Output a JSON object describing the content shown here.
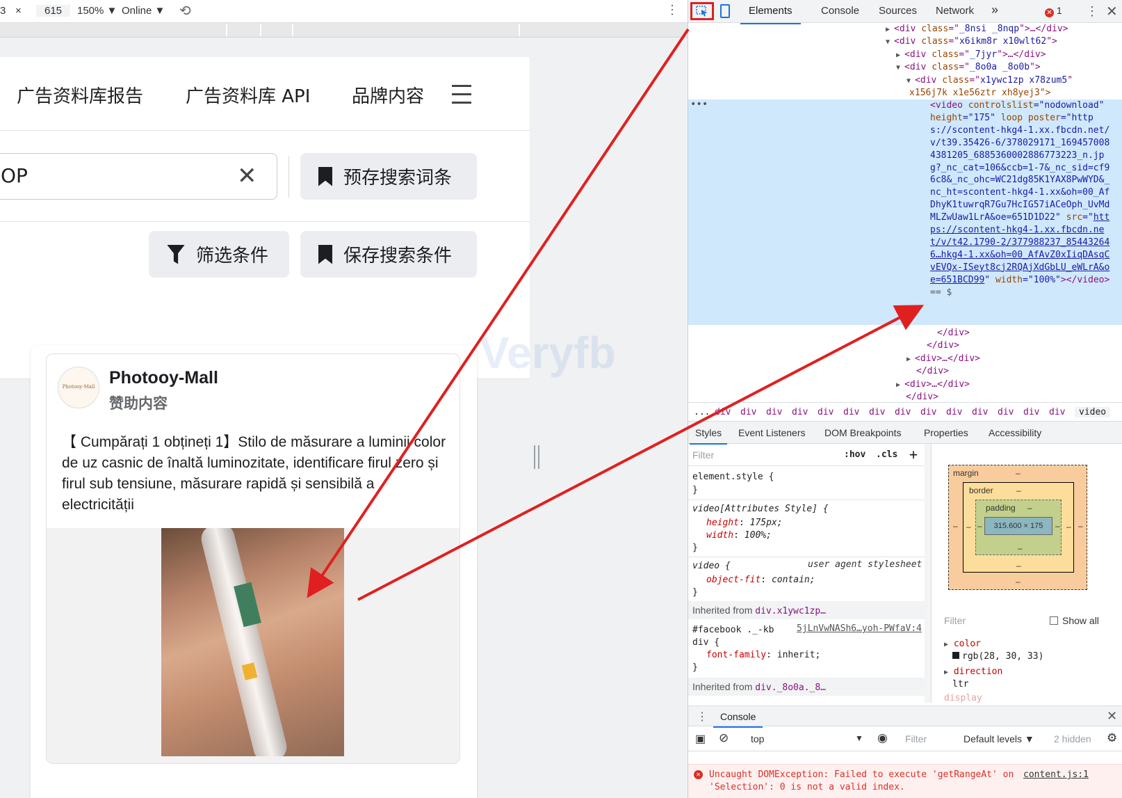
{
  "device_toolbar": {
    "width": "3",
    "times": "×",
    "height": "615",
    "zoom": "150% ▼",
    "network": "Online ▼",
    "rotate_icon": "rotate-icon"
  },
  "site": {
    "nav": [
      "广告资料库报告",
      "广告资料库 API",
      "品牌内容"
    ],
    "search_value": "OP",
    "save_terms": "预存搜索词条",
    "filter": "筛选条件",
    "save_search": "保存搜索条件",
    "watermark": "Veryfb"
  },
  "ad": {
    "avatar_text": "Photooy-Mall",
    "page_name": "Photooy-Mall",
    "sponsored": "赞助内容",
    "body": "【 Cumpărați 1 obțineți 1】Stilo de măsurare a luminii color de uz casnic de înaltă luminozitate, identificare firul zero și firul sub tensiune, măsurare rapidă și sensibilă a electricității"
  },
  "devtools": {
    "tabs": [
      "Elements",
      "Console",
      "Sources",
      "Network",
      "»"
    ],
    "error_count": "1",
    "dom_lines": [
      {
        "indent": 0,
        "tri": "▶",
        "cls": "_8nsi _8nqp",
        "tail": ">…</div>"
      },
      {
        "indent": 0,
        "tri": "▼",
        "cls": "x6ikm8r x10wlt62",
        "tail": ">"
      },
      {
        "indent": 1,
        "tri": "▶",
        "cls": "_7jyr",
        "tail": ">…</div>"
      },
      {
        "indent": 1,
        "tri": "▼",
        "cls": "_8o0a _8o0b",
        "tail": ">"
      },
      {
        "indent": 2,
        "tri": "▼",
        "cls": "x1ywc1zp x78zum5",
        "tail": ""
      }
    ],
    "dom_wrap": "x156j7k x1e56ztr xh8yej3\">",
    "video_tag": {
      "controlslist": "nodownload",
      "height": "175",
      "poster": "https://scontent-hkg4-1.xx.fbcdn.net/v/t39.35426-6/378029171_1694570084381205_6885360002886773223_n.jpg?_nc_cat=106&ccb=1-7&_nc_sid=cf96c8&_nc_ohc=WC21dg85K1YAX8PwWYD&_nc_ht=scontent-hkg4-1.xx&oh=00_AfDhyK1tuwrqR7Gu7HcIG57iACeOph_UvMdMLZwUaw1LrA&oe=651D1D22",
      "src": "https://scontent-hkg4-1.xx.fbcdn.net/v/t42.1790-2/377988237_854432646…hkg4-1.xx&oh=00_AfAvZ0xIiqDAsqCvEVQx-ISeyt8cj2RQAjXdGbLU_eWLrA&oe=651BCD99",
      "width": "100%",
      "suffix": "== $"
    },
    "closing_lines": [
      {
        "indent": 3,
        "text": "</div>"
      },
      {
        "indent": 2,
        "text": "</div>"
      },
      {
        "indent": 1,
        "tri": "▶",
        "text": "<div>…</div>"
      },
      {
        "indent": 1,
        "text": "</div>"
      },
      {
        "indent": 0,
        "tri": "▶",
        "text": "<div>…</div>"
      },
      {
        "indent": 0,
        "text": "</div>"
      }
    ],
    "breadcrumbs": [
      "...",
      "div",
      "div",
      "div",
      "div",
      "div",
      "div",
      "div",
      "div",
      "div",
      "div",
      "div",
      "div",
      "div",
      "div",
      "video"
    ],
    "subtabs": [
      "Styles",
      "Event Listeners",
      "DOM Breakpoints",
      "Properties",
      "Accessibility"
    ],
    "styles_filter": "Filter",
    "hov": ":hov",
    "cls": ".cls",
    "plus": "+",
    "rules": {
      "element_style": "element.style {",
      "attr_selector": "video[Attributes Style] {",
      "height_prop": "height",
      "height_val": "175px;",
      "width_prop": "width",
      "width_val": "100%;",
      "video_selector": "video {",
      "ua_label": "user agent stylesheet",
      "objfit_prop": "object-fit",
      "objfit_val": "contain;",
      "inherited_1_label": "Inherited from",
      "inherited_1_sel": "div.x1ywc1zp…",
      "fb_selector": "#facebook ._-kb",
      "fb_selector2": "div {",
      "fb_src": "5jLnVwNASh6…yoh-PWfaV:4",
      "ff_prop": "font-family",
      "ff_val": "inherit;",
      "inherited_2_label": "Inherited from",
      "inherited_2_sel": "div._8o0a._8…",
      "close": "}"
    },
    "box_model": {
      "margin": "margin",
      "border": "border",
      "padding": "padding",
      "dash": "–",
      "content": "315.600 × 175"
    },
    "computed": {
      "filter": "Filter",
      "show_all": "Show all",
      "color_prop": "color",
      "color_val": "rgb(28, 30, 33)",
      "direction_prop": "direction",
      "direction_val": "ltr",
      "display_prop": "display"
    },
    "drawer": {
      "tab": "Console",
      "context": "top",
      "filter": "Filter",
      "levels": "Default levels ▼",
      "hidden": "2 hidden",
      "error_msg": "Uncaught DOMException: Failed to execute 'getRangeAt' on 'Selection': 0 is not a valid index.",
      "error_src": "content.js:1"
    }
  },
  "colors": {
    "arrow": "#e02020",
    "selection": "#cfe8fc",
    "accent": "#1a73e8"
  }
}
